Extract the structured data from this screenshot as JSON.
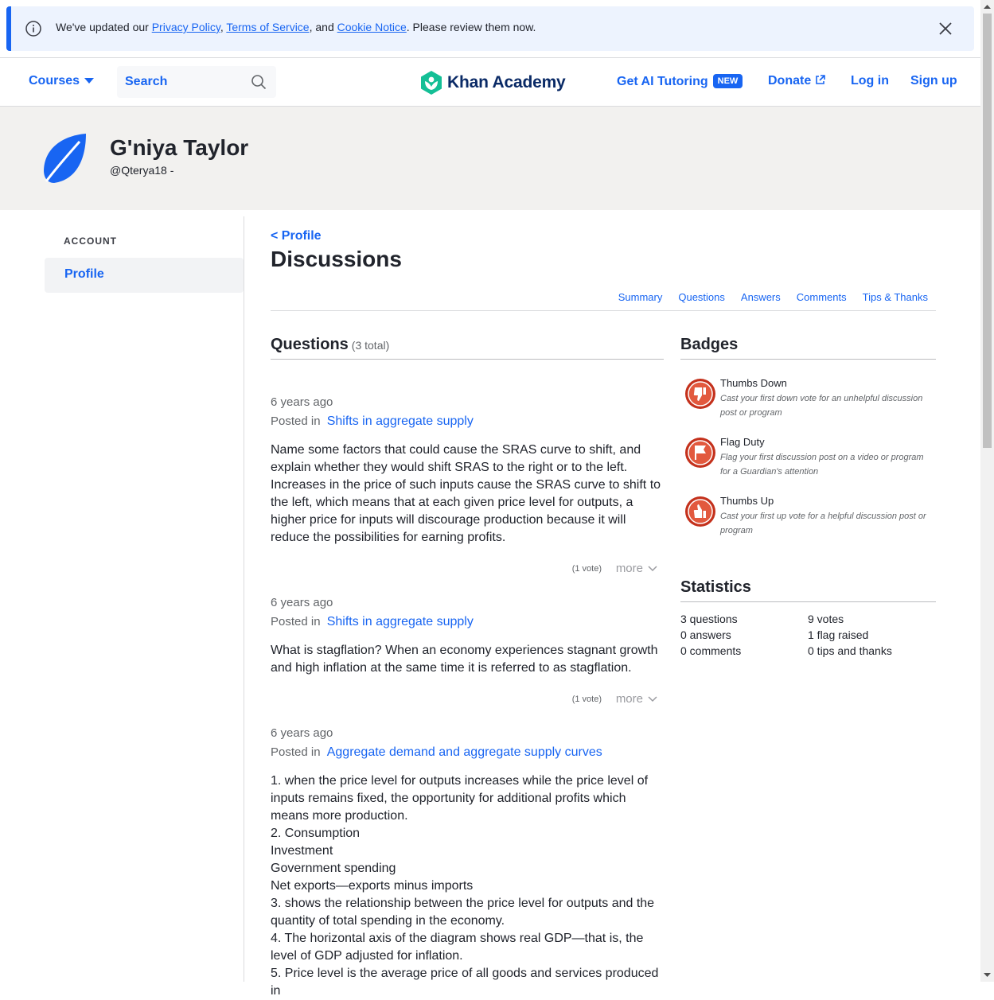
{
  "notice": {
    "prefix": "We've updated our ",
    "link1": "Privacy Policy",
    "sep1": ", ",
    "link2": "Terms of Service",
    "sep2": ", and ",
    "link3": "Cookie Notice",
    "suffix": ". Please review them now."
  },
  "header": {
    "courses": "Courses",
    "search_placeholder": "Search",
    "logo": "Khan Academy",
    "ai_tutoring": "Get AI Tutoring",
    "new_badge": "NEW",
    "donate": "Donate",
    "login": "Log in",
    "signup": "Sign up"
  },
  "profile": {
    "name": "G'niya Taylor",
    "handle": "@Qterya18 -"
  },
  "sidebar": {
    "section": "ACCOUNT",
    "items": [
      {
        "label": "Profile"
      }
    ]
  },
  "main": {
    "back": "< Profile",
    "title": "Discussions",
    "tabs": [
      "Summary",
      "Questions",
      "Answers",
      "Comments",
      "Tips & Thanks"
    ],
    "questions_heading": "Questions",
    "questions_count": "(3 total)",
    "posted_in": "Posted in",
    "more": "more",
    "posts": [
      {
        "time": "6 years ago",
        "topic": "Shifts in aggregate supply",
        "body": "Name some factors that could cause the SRAS curve to shift, and explain whether they would shift SRAS to the right or to the left. Increases in the price of such inputs cause the SRAS curve to shift to the left, which means that at each given price level for outputs, a higher price for inputs will discourage production because it will reduce the possibilities for earning profits.",
        "votes": "(1 vote)"
      },
      {
        "time": "6 years ago",
        "topic": "Shifts in aggregate supply",
        "body": "What is stagflation? When an economy experiences stagnant growth and high inflation at the same time it is referred to as stagflation.",
        "votes": "(1 vote)"
      },
      {
        "time": "6 years ago",
        "topic": "Aggregate demand and aggregate supply curves",
        "body": "1. when the price level for outputs increases while the price level of inputs remains fixed, the opportunity for additional profits which means more production.\n2. Consumption\nInvestment\nGovernment spending\nNet exports—exports minus imports\n3. shows the relationship between the price level for outputs and the quantity of total spending in the economy.\n4. The horizontal axis of the diagram shows real GDP—that is, the level of GDP adjusted for inflation.\n5. Price level is the average price of all goods and services produced in"
      }
    ]
  },
  "badges": {
    "heading": "Badges",
    "items": [
      {
        "name": "Thumbs Down",
        "desc": "Cast your first down vote for an unhelpful discussion post or program",
        "icon": "thumbs-down-icon"
      },
      {
        "name": "Flag Duty",
        "desc": "Flag your first discussion post on a video or program for a Guardian's attention",
        "icon": "flag-icon"
      },
      {
        "name": "Thumbs Up",
        "desc": "Cast your first up vote for a helpful discussion post or program",
        "icon": "thumbs-up-icon"
      }
    ]
  },
  "statistics": {
    "heading": "Statistics",
    "left": [
      "3 questions",
      "0 answers",
      "0 comments"
    ],
    "right": [
      "9 votes",
      "1 flag raised",
      "0 tips and thanks"
    ]
  },
  "colors": {
    "accent": "#1865f2",
    "logo_green": "#14bf96",
    "badge_red": "#c4311c",
    "band": "#f2f1ef"
  }
}
